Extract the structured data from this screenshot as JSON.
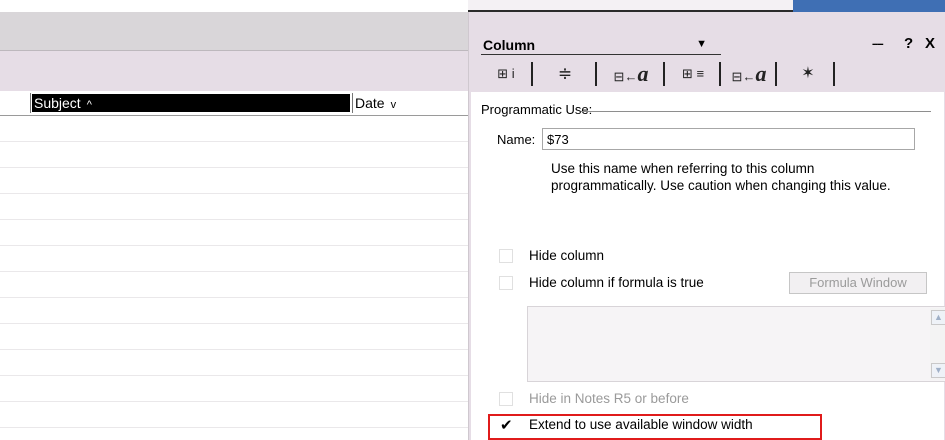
{
  "view": {
    "columns": [
      {
        "label": "Subject",
        "sort_icon": "sort-ascending-icon",
        "sort_glyph": "^"
      },
      {
        "label": "Date",
        "sort_icon": "sort-descending-icon",
        "sort_glyph": "v"
      }
    ]
  },
  "properties": {
    "selector_value": "Column",
    "window_icons": {
      "dock": "----",
      "help": "?",
      "close": "X"
    },
    "tabs": [
      {
        "icon": "column-info-tab-icon",
        "glyph": "⊞ i"
      },
      {
        "icon": "sorting-tab-icon",
        "glyph": "≑"
      },
      {
        "icon": "column-font-tab-icon",
        "glyph": "a"
      },
      {
        "icon": "numbers-tab-icon",
        "glyph": "⊞ ≡"
      },
      {
        "icon": "title-font-tab-icon",
        "glyph": "a"
      },
      {
        "icon": "advanced-tab-icon",
        "glyph": "✶"
      }
    ],
    "section_title": "Programmatic Use:",
    "name_label": "Name:",
    "name_value": "$73",
    "help_text": "Use this name when referring to this column programmatically.  Use caution when changing this value.",
    "hide_column": {
      "label": "Hide column",
      "checked": false
    },
    "hide_if_formula": {
      "label": "Hide column if formula is true",
      "checked": false
    },
    "formula_button": "Formula Window",
    "hide_in_notes": {
      "label": "Hide in Notes R5 or before",
      "checked": false,
      "disabled": true
    },
    "extend_width": {
      "label": "Extend to use available window width",
      "checked": true
    }
  }
}
